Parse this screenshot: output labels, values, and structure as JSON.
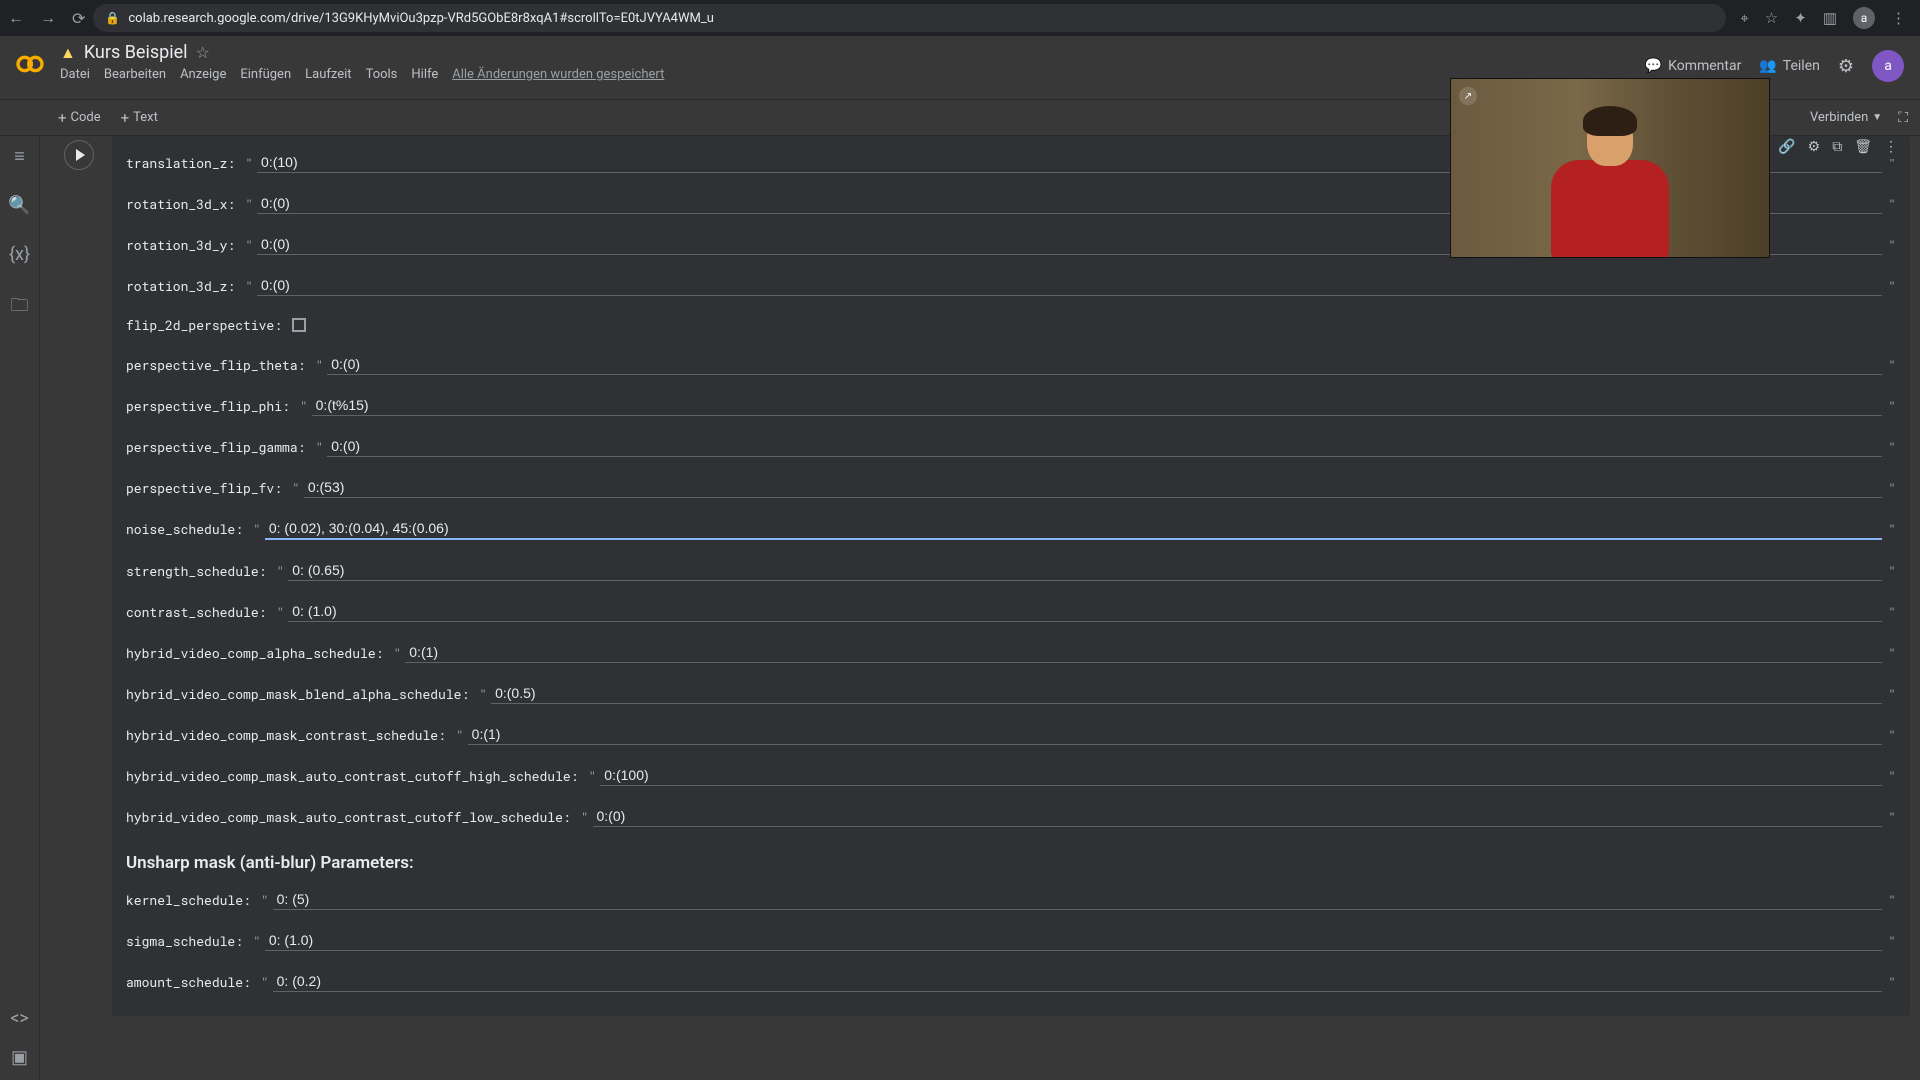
{
  "browser": {
    "url": "colab.research.google.com/drive/13G9KHyMviOu3pzp-VRd5GObE8r8xqA1#scrollTo=E0tJVYA4WM_u",
    "avatar": "a"
  },
  "header": {
    "title": "Kurs Beispiel",
    "menus": [
      "Datei",
      "Bearbeiten",
      "Anzeige",
      "Einfügen",
      "Laufzeit",
      "Tools",
      "Hilfe"
    ],
    "saved_msg": "Alle Änderungen wurden gespeichert",
    "comment": "Kommentar",
    "share": "Teilen",
    "avatar": "a"
  },
  "toolbar": {
    "code": "Code",
    "text": "Text",
    "connect": "Verbinden"
  },
  "params": {
    "section2": "Unsharp mask (anti-blur) Parameters:",
    "rows": [
      {
        "label": "translation_z:",
        "value": "0:(10)"
      },
      {
        "label": "rotation_3d_x:",
        "value": "0:(0)"
      },
      {
        "label": "rotation_3d_y:",
        "value": "0:(0)"
      },
      {
        "label": "rotation_3d_z:",
        "value": "0:(0)"
      },
      {
        "label": "flip_2d_perspective:",
        "checkbox": true
      },
      {
        "label": "perspective_flip_theta:",
        "value": "0:(0)"
      },
      {
        "label": "perspective_flip_phi:",
        "value": "0:(t%15)"
      },
      {
        "label": "perspective_flip_gamma:",
        "value": "0:(0)"
      },
      {
        "label": "perspective_flip_fv:",
        "value": "0:(53)"
      },
      {
        "label": "noise_schedule:",
        "value": "0: (0.02), 30:(0.04), 45:(0.06)",
        "focused": true
      },
      {
        "label": "strength_schedule:",
        "value": "0: (0.65)"
      },
      {
        "label": "contrast_schedule:",
        "value": "0: (1.0)"
      },
      {
        "label": "hybrid_video_comp_alpha_schedule:",
        "value": "0:(1)"
      },
      {
        "label": "hybrid_video_comp_mask_blend_alpha_schedule:",
        "value": "0:(0.5)"
      },
      {
        "label": "hybrid_video_comp_mask_contrast_schedule:",
        "value": "0:(1)"
      },
      {
        "label": "hybrid_video_comp_mask_auto_contrast_cutoff_high_schedule:",
        "value": "0:(100)"
      },
      {
        "label": "hybrid_video_comp_mask_auto_contrast_cutoff_low_schedule:",
        "value": "0:(0)"
      }
    ],
    "rows2": [
      {
        "label": "kernel_schedule:",
        "value": "0: (5)"
      },
      {
        "label": "sigma_schedule:",
        "value": "0: (1.0)"
      },
      {
        "label": "amount_schedule:",
        "value": "0: (0.2)"
      }
    ]
  }
}
